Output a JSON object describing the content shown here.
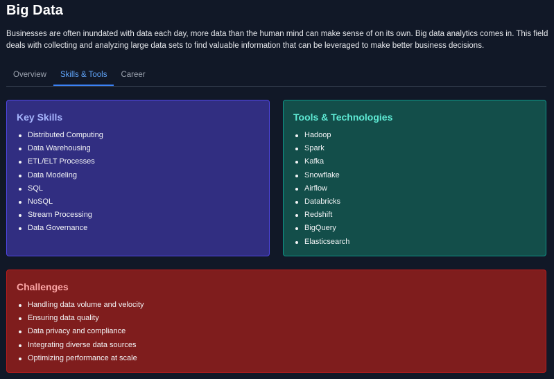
{
  "page": {
    "title": "Big Data",
    "description": "Businesses are often inundated with data each day, more data than the human mind can make sense of on its own. Big data analytics comes in. This field deals with collecting and analyzing large data sets to find valuable information that can be leveraged to make better business decisions."
  },
  "tabs": [
    {
      "label": "Overview",
      "active": false
    },
    {
      "label": "Skills & Tools",
      "active": true
    },
    {
      "label": "Career",
      "active": false
    }
  ],
  "skills": {
    "title": "Key Skills",
    "items": [
      "Distributed Computing",
      "Data Warehousing",
      "ETL/ELT Processes",
      "Data Modeling",
      "SQL",
      "NoSQL",
      "Stream Processing",
      "Data Governance"
    ]
  },
  "tools": {
    "title": "Tools & Technologies",
    "items": [
      "Hadoop",
      "Spark",
      "Kafka",
      "Snowflake",
      "Airflow",
      "Databricks",
      "Redshift",
      "BigQuery",
      "Elasticsearch"
    ]
  },
  "challenges": {
    "title": "Challenges",
    "items": [
      "Handling data volume and velocity",
      "Ensuring data quality",
      "Data privacy and compliance",
      "Integrating diverse data sources",
      "Optimizing performance at scale"
    ]
  },
  "colors": {
    "background": "#111827",
    "tab_active": "#60a5fa",
    "skills_card": "#312e81",
    "tools_card": "#134e4a",
    "challenges_card": "#7f1d1d"
  }
}
